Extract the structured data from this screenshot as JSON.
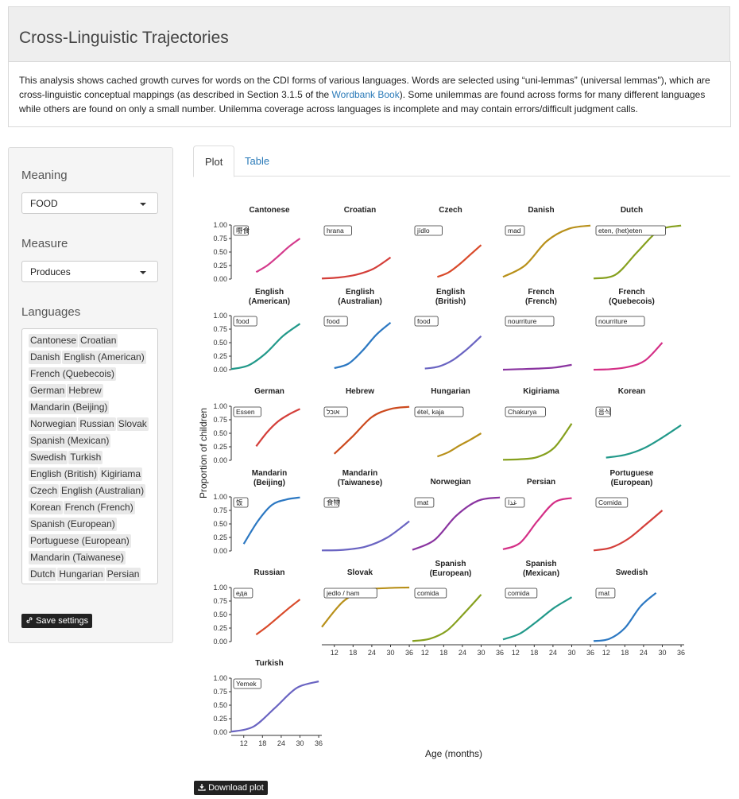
{
  "header": {
    "title": "Cross-Linguistic Trajectories"
  },
  "description": {
    "text_before_link": "This analysis shows cached growth curves for words on the CDI forms of various languages. Words are selected using “uni-lemmas” (universal lemmas\"), which are cross-linguistic conceptual mappings (as described in Section 3.1.5 of the ",
    "link_text": "Wordbank Book",
    "text_after_link": "). Some unilemmas are found across forms for many different languages while others are found on only a small number. Unilemma coverage across languages is incomplete and may contain errors/difficult judgment calls."
  },
  "sidebar": {
    "meaning_label": "Meaning",
    "meaning_value": "FOOD",
    "measure_label": "Measure",
    "measure_value": "Produces",
    "languages_label": "Languages",
    "languages": [
      "Cantonese",
      "Croatian",
      "Danish",
      "English (American)",
      "French (Quebecois)",
      "German",
      "Hebrew",
      "Mandarin (Beijing)",
      "Norwegian",
      "Russian",
      "Slovak",
      "Spanish (Mexican)",
      "Swedish",
      "Turkish",
      "English (British)",
      "Kigiriama",
      "Czech",
      "English (Australian)",
      "Korean",
      "French (French)",
      "Spanish (European)",
      "Portuguese (European)",
      "Mandarin (Taiwanese)",
      "Dutch",
      "Hungarian",
      "Persian"
    ],
    "save_label": "Save settings"
  },
  "tabs": {
    "plot": "Plot",
    "table": "Table"
  },
  "download_label": "Download plot",
  "chart_data": {
    "type": "line",
    "facets": true,
    "ylabel": "Proportion of children",
    "xlabel": "Age (months)",
    "xticks": [
      12,
      18,
      24,
      30,
      36
    ],
    "yticks": [
      "0.00",
      "0.25",
      "0.50",
      "0.75",
      "1.00"
    ],
    "xlim": [
      8,
      37
    ],
    "ylim": [
      0,
      1
    ],
    "panels": [
      {
        "title": [
          "Cantonese"
        ],
        "word": "嘢食",
        "color": "#d43a8c",
        "x0": 16,
        "x1": 30,
        "y": [
          0.13,
          0.25,
          0.42,
          0.6,
          0.75
        ]
      },
      {
        "title": [
          "Croatian"
        ],
        "word": "hrana",
        "color": "#d43f3a",
        "x0": 8,
        "x1": 30,
        "y": [
          0.01,
          0.03,
          0.08,
          0.19,
          0.4
        ]
      },
      {
        "title": [
          "Czech"
        ],
        "word": "jídlo",
        "color": "#d94a2a",
        "x0": 16,
        "x1": 30,
        "y": [
          0.04,
          0.12,
          0.27,
          0.45,
          0.63
        ]
      },
      {
        "title": [
          "Danish"
        ],
        "word": "mad",
        "color": "#b8901a",
        "x0": 8,
        "x1": 36,
        "y": [
          0.04,
          0.25,
          0.7,
          0.93,
          0.99
        ]
      },
      {
        "title": [
          "Dutch"
        ],
        "word": "eten, (het)eten",
        "color": "#86a01e",
        "x0": 8,
        "x1": 36,
        "y": [
          0.01,
          0.08,
          0.5,
          0.9,
          0.99
        ]
      },
      {
        "title": [
          "English",
          "(American)"
        ],
        "word": "food",
        "color": "#22998a",
        "x0": 8,
        "x1": 30,
        "y": [
          0.01,
          0.08,
          0.3,
          0.62,
          0.85
        ]
      },
      {
        "title": [
          "English",
          "(Australian)"
        ],
        "word": "food",
        "color": "#2c78c2",
        "x0": 12,
        "x1": 30,
        "y": [
          0.03,
          0.11,
          0.35,
          0.65,
          0.87
        ]
      },
      {
        "title": [
          "English",
          "(British)"
        ],
        "word": "food",
        "color": "#6a64c2",
        "x0": 12,
        "x1": 30,
        "y": [
          0.02,
          0.06,
          0.18,
          0.38,
          0.62
        ]
      },
      {
        "title": [
          "French",
          "(French)"
        ],
        "word": "nourriture",
        "color": "#8a34a0",
        "x0": 8,
        "x1": 30,
        "y": [
          0.0,
          0.01,
          0.02,
          0.04,
          0.09
        ]
      },
      {
        "title": [
          "French",
          "(Quebecois)"
        ],
        "word": "nourriture",
        "color": "#d42f86",
        "x0": 8,
        "x1": 30,
        "y": [
          0.0,
          0.01,
          0.05,
          0.17,
          0.5
        ]
      },
      {
        "title": [
          "German"
        ],
        "word": "Essen",
        "color": "#d43f3a",
        "x0": 16,
        "x1": 30,
        "y": [
          0.26,
          0.52,
          0.72,
          0.85,
          0.95
        ]
      },
      {
        "title": [
          "Hebrew"
        ],
        "word": "אוכל",
        "color": "#cc4a1e",
        "x0": 12,
        "x1": 36,
        "y": [
          0.12,
          0.45,
          0.8,
          0.95,
          0.99
        ]
      },
      {
        "title": [
          "Hungarian"
        ],
        "word": "étel, kaja",
        "color": "#b8901a",
        "x0": 16,
        "x1": 30,
        "y": [
          0.07,
          0.15,
          0.27,
          0.38,
          0.5
        ]
      },
      {
        "title": [
          "Kigiriama"
        ],
        "word": "Chakurya",
        "color": "#86a01e",
        "x0": 8,
        "x1": 30,
        "y": [
          0.01,
          0.02,
          0.06,
          0.24,
          0.68
        ]
      },
      {
        "title": [
          "Korean"
        ],
        "word": "음식",
        "color": "#22998a",
        "x0": 12,
        "x1": 36,
        "y": [
          0.05,
          0.1,
          0.22,
          0.42,
          0.65
        ]
      },
      {
        "title": [
          "Mandarin",
          "(Beijing)"
        ],
        "word": "饭",
        "color": "#2c78c2",
        "x0": 12,
        "x1": 30,
        "y": [
          0.13,
          0.55,
          0.85,
          0.95,
          0.99
        ]
      },
      {
        "title": [
          "Mandarin",
          "(Taiwanese)"
        ],
        "word": "食物",
        "color": "#6a64c2",
        "x0": 8,
        "x1": 36,
        "y": [
          0.01,
          0.02,
          0.08,
          0.25,
          0.55
        ]
      },
      {
        "title": [
          "Norwegian"
        ],
        "word": "mat",
        "color": "#8a34a0",
        "x0": 8,
        "x1": 36,
        "y": [
          0.02,
          0.2,
          0.65,
          0.93,
          0.99
        ]
      },
      {
        "title": [
          "Persian"
        ],
        "word": "غذا",
        "color": "#d42f86",
        "x0": 8,
        "x1": 30,
        "y": [
          0.03,
          0.15,
          0.55,
          0.9,
          0.98
        ]
      },
      {
        "title": [
          "Portuguese",
          "(European)"
        ],
        "word": "Comida",
        "color": "#d43f3a",
        "x0": 8,
        "x1": 30,
        "y": [
          0.01,
          0.06,
          0.22,
          0.48,
          0.75
        ]
      },
      {
        "title": [
          "Russian"
        ],
        "word": "еда",
        "color": "#d94a2a",
        "x0": 16,
        "x1": 30,
        "y": [
          0.13,
          0.28,
          0.45,
          0.62,
          0.78
        ]
      },
      {
        "title": [
          "Slovak"
        ],
        "word": "jedlo / ham",
        "color": "#b8901a",
        "x0": 8,
        "x1": 36,
        "y": [
          0.27,
          0.75,
          0.95,
          0.99,
          1.0
        ]
      },
      {
        "title": [
          "Spanish",
          "(European)"
        ],
        "word": "comida",
        "color": "#86a01e",
        "x0": 8,
        "x1": 30,
        "y": [
          0.01,
          0.05,
          0.2,
          0.52,
          0.87
        ]
      },
      {
        "title": [
          "Spanish",
          "(Mexican)"
        ],
        "word": "comida",
        "color": "#22998a",
        "x0": 8,
        "x1": 30,
        "y": [
          0.04,
          0.15,
          0.38,
          0.63,
          0.82
        ]
      },
      {
        "title": [
          "Swedish"
        ],
        "word": "mat",
        "color": "#2c78c2",
        "x0": 8,
        "x1": 28,
        "y": [
          0.01,
          0.05,
          0.25,
          0.65,
          0.9
        ]
      },
      {
        "title": [
          "Turkish"
        ],
        "word": "Yemek",
        "color": "#6a64c2",
        "x0": 8,
        "x1": 36,
        "y": [
          0.01,
          0.1,
          0.45,
          0.82,
          0.94
        ]
      }
    ]
  }
}
